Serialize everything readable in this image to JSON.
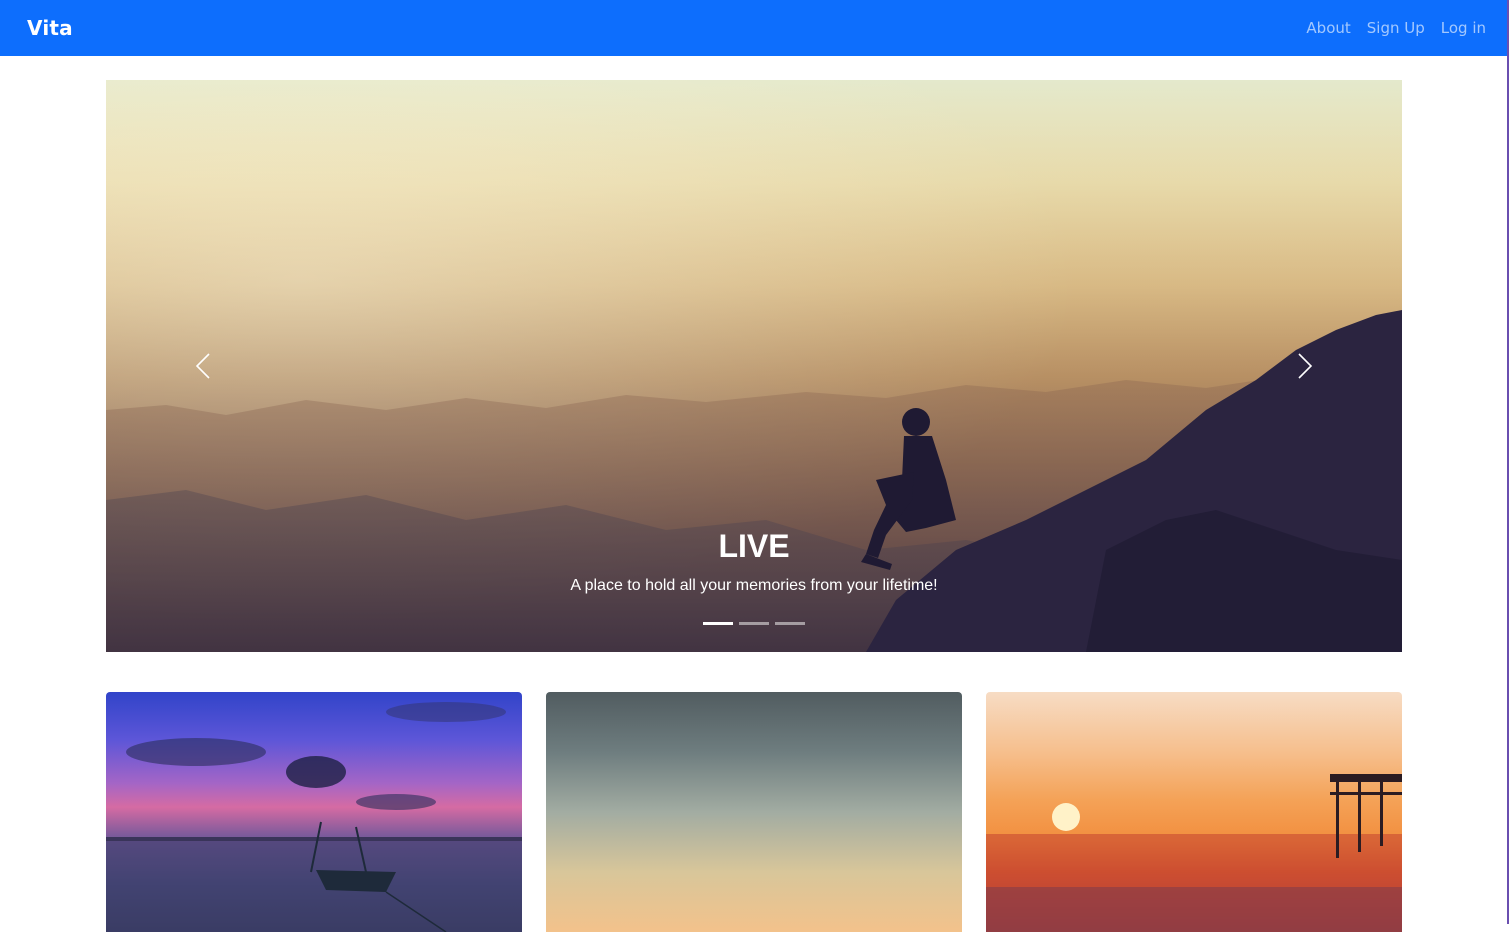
{
  "navbar": {
    "brand": "Vita",
    "links": [
      "About",
      "Sign Up",
      "Log in"
    ],
    "background_color": "#0d6efd"
  },
  "carousel": {
    "slides_count": 3,
    "active_index": 0,
    "caption": {
      "title": "LIVE",
      "text": "A place to hold all your memories from your lifetime!"
    },
    "icons": {
      "prev": "chevron-left-icon",
      "next": "chevron-right-icon"
    }
  },
  "cards": [
    {
      "image": "sunset-lake-boat"
    },
    {
      "image": "dusk-sky"
    },
    {
      "image": "beach-sunset-pier"
    }
  ]
}
